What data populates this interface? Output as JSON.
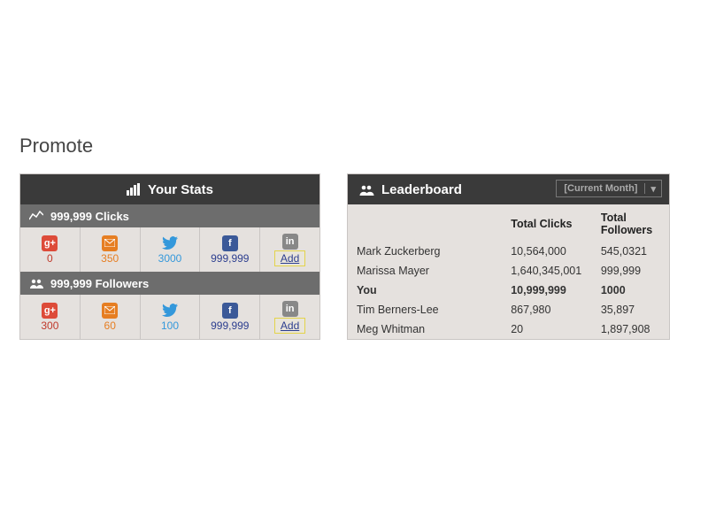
{
  "page": {
    "title": "Promote"
  },
  "stats": {
    "header": "Your Stats",
    "clicks": {
      "label": "999,999 Clicks",
      "items": {
        "gplus": "0",
        "mail": "350",
        "twitter": "3000",
        "facebook": "999,999",
        "linkedin_add": "Add"
      }
    },
    "followers": {
      "label": "999,999 Followers",
      "items": {
        "gplus": "300",
        "mail": "60",
        "twitter": "100",
        "facebook": "999,999",
        "linkedin_add": "Add"
      }
    }
  },
  "leaderboard": {
    "header": "Leaderboard",
    "filter": "[Current Month]",
    "columns": {
      "name": "",
      "clicks": "Total Clicks",
      "followers": "Total Followers"
    },
    "rows": [
      {
        "name": "Mark Zuckerberg",
        "clicks": "10,564,000",
        "followers": "545,0321",
        "you": false
      },
      {
        "name": "Marissa Mayer",
        "clicks": "1,640,345,001",
        "followers": "999,999",
        "you": false
      },
      {
        "name": "You",
        "clicks": "10,999,999",
        "followers": "1000",
        "you": true
      },
      {
        "name": "Tim Berners-Lee",
        "clicks": "867,980",
        "followers": "35,897",
        "you": false
      },
      {
        "name": "Meg Whitman",
        "clicks": "20",
        "followers": "1,897,908",
        "you": false
      }
    ]
  }
}
